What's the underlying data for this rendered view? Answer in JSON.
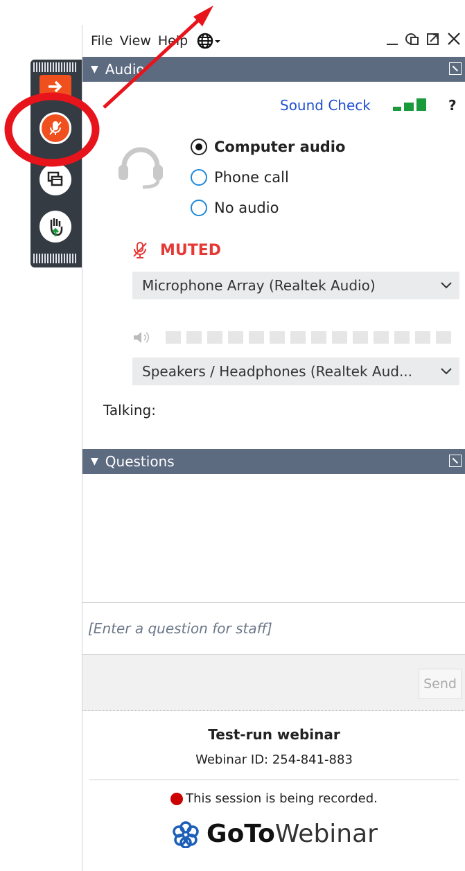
{
  "menubar": {
    "file": "File",
    "view": "View",
    "help": "Help"
  },
  "audio_section": {
    "title": "Audio",
    "sound_check": "Sound Check",
    "help_mark": "?",
    "options": [
      {
        "label": "Computer audio",
        "selected": true
      },
      {
        "label": "Phone call",
        "selected": false
      },
      {
        "label": "No audio",
        "selected": false
      }
    ],
    "muted_label": "MUTED",
    "microphone": "Microphone Array (Realtek Audio)",
    "speakers": "Speakers / Headphones (Realtek Aud...",
    "talking": "Talking:"
  },
  "questions_section": {
    "title": "Questions",
    "placeholder": "[Enter a question for staff]",
    "send": "Send"
  },
  "footer": {
    "webinar_title": "Test-run webinar",
    "webinar_id": "Webinar ID: 254-841-883",
    "recording": "This session is being recorded.",
    "logo_goto": "GoTo",
    "logo_webinar": "Webinar"
  },
  "colors": {
    "header": "#5d6b81",
    "muted_red": "#e53935",
    "link_blue": "#1f4fd1",
    "annotation_red": "#e8141b"
  },
  "icons": [
    "arrow-out-icon",
    "mic-muted-icon",
    "screen-icon",
    "raise-hand-icon",
    "globe-icon",
    "headset-icon",
    "speaker-icon"
  ]
}
